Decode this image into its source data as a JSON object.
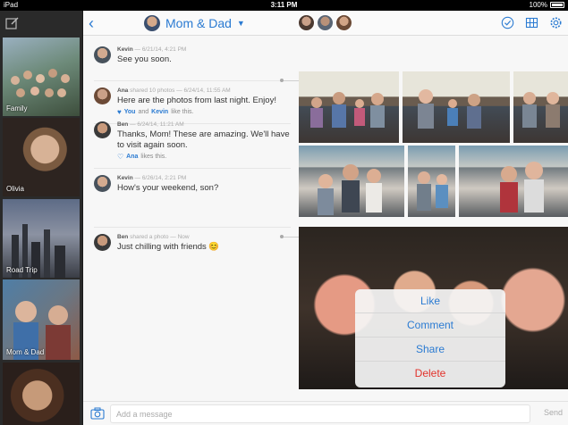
{
  "statusbar": {
    "carrier": "iPad",
    "wifi_icon": "wifi-icon",
    "time": "3:11 PM",
    "battery": "100%"
  },
  "sidebar": {
    "compose_icon": "compose-icon",
    "items": [
      {
        "label": "Family"
      },
      {
        "label": "Olivia"
      },
      {
        "label": "Road Trip"
      },
      {
        "label": "Mom & Dad"
      },
      {
        "label": ""
      }
    ]
  },
  "header": {
    "title": "Mom & Dad",
    "back_icon": "chevron-left-icon",
    "caret_icon": "caret-down-icon",
    "icons": [
      "check-circle-icon",
      "grid-icon",
      "gear-icon"
    ]
  },
  "messages": [
    {
      "author": "Kevin",
      "action": "",
      "time": "— 6/21/14, 4:21 PM",
      "text": "See you soon.",
      "likes": null
    },
    {
      "author": "Ana",
      "action": "shared 10 photos",
      "time": "— 6/24/14, 11:55 AM",
      "text": "Here are the photos from last night. Enjoy!",
      "likes": {
        "names": [
          "You",
          "Kevin"
        ],
        "joiner": "and",
        "suffix": "like this."
      }
    },
    {
      "author": "Ben",
      "action": "",
      "time": "— 6/24/14, 11:21 AM",
      "text": "Thanks, Mom! These are amazing. We'll have to visit again soon.",
      "likes": {
        "names": [
          "Ana"
        ],
        "suffix": "likes this."
      }
    },
    {
      "author": "Kevin",
      "action": "",
      "time": "— 6/26/14, 2:21 PM",
      "text": "How's your weekend, son?",
      "likes": null
    },
    {
      "author": "Ben",
      "action": "shared a photo",
      "time": "— Now",
      "text": "Just chilling with friends 😊",
      "likes": null
    }
  ],
  "action_menu": {
    "like": "Like",
    "comment": "Comment",
    "share": "Share",
    "delete": "Delete",
    "delete_color": "#e2332b"
  },
  "composer": {
    "placeholder": "Add a message",
    "send": "Send",
    "camera_icon": "camera-icon"
  },
  "colors": {
    "accent": "#2b7bd2",
    "delete": "#e2332b"
  }
}
